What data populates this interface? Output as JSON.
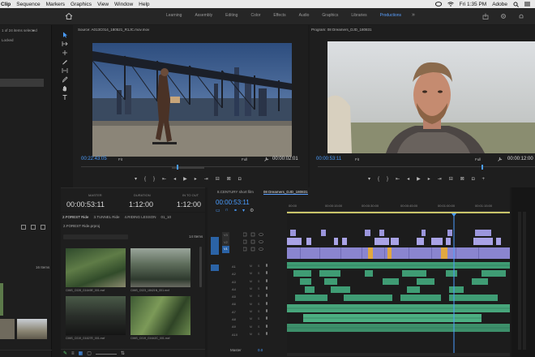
{
  "menubar": {
    "items": [
      "Clip",
      "Sequence",
      "Markers",
      "Graphics",
      "View",
      "Window",
      "Help"
    ],
    "time": "Fri 1:35 PM",
    "app": "Adobe"
  },
  "workspaces": {
    "tabs": [
      "Learning",
      "Assembly",
      "Editing",
      "Color",
      "Effects",
      "Audio",
      "Graphics",
      "Libraries",
      "Productions"
    ],
    "active": "Productions",
    "more": "»"
  },
  "project": {
    "selected_text": "1 of 24 items selected",
    "locked_text": "Locked",
    "items_count": "16 Items"
  },
  "source_monitor": {
    "title": "Source: A013C014_180521_R1JC.mov.mov",
    "timecode": "00:22:43:05",
    "fit": "Fit",
    "quality": "Full",
    "duration": "00:00:02:01"
  },
  "program_monitor": {
    "title": "Program: 08 Dreamers_DJD_180831",
    "timecode": "00:00:53:11",
    "fit": "Fit",
    "quality": "Full",
    "duration": "00:00:12:00"
  },
  "tc_bar": {
    "master_label": "MASTER",
    "master_value": "00:00:53:11",
    "duration_label": "DURATION",
    "duration_value": "1:12:00",
    "in_out_label": "IN TO OUT",
    "in_out_value": "1:12:00"
  },
  "bin": {
    "tabs": [
      "2.FOREST Ride",
      "3.TUNNEL Ride",
      "4.RIDING LESSON",
      "01_10"
    ],
    "active_tab": "2.FOREST Ride",
    "path": "2.FOREST Ride.prproj",
    "count": "14 Items",
    "thumbs": [
      {
        "caption": "CIMS_C028_G1649E_001.mxf"
      },
      {
        "caption": "CIMS_C023_18421N_001.mxf"
      },
      {
        "caption": "CIMS_C019_G1627E_001.mxf"
      },
      {
        "caption": "CIMS_C019_G1642C_001.mxf"
      }
    ]
  },
  "timeline": {
    "tabs": [
      "8.CENTURY short film",
      "08 Dreamers_DJD_180831"
    ],
    "active_tab": "08 Dreamers_DJD_180831",
    "timecode": "00:00:53:11",
    "ruler": [
      "00:00",
      "00:00:15:00",
      "00:00:30:00",
      "00:00:45:00",
      "00:01:00:00",
      "00:01:15:00"
    ],
    "video_tracks": [
      "V3",
      "V2",
      "V1"
    ],
    "audio_tracks": [
      "A1",
      "A2",
      "A3",
      "A4",
      "A5",
      "A6",
      "A7",
      "A8",
      "A9",
      "A10"
    ],
    "master_label": "Master",
    "master_value": "0.0"
  },
  "colors": {
    "accent": "#4a9dff",
    "video_clip": "#8f8ad6",
    "audio_clip": "#3d9f72",
    "playhead": "#4a9dff"
  }
}
